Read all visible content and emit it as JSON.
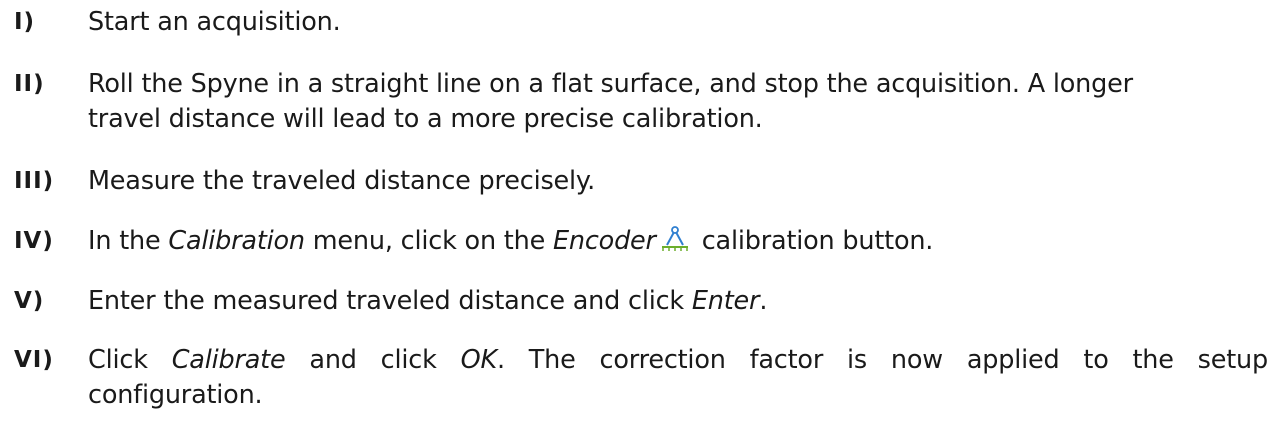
{
  "steps": [
    {
      "number": "I)",
      "text": "Start an acquisition."
    },
    {
      "number": "II)",
      "line1": "Roll the Spyne in a straight line on a flat surface, and stop the acquisition. A longer",
      "line2": "travel distance will lead to a more precise calibration."
    },
    {
      "number": "III)",
      "text": "Measure the traveled distance precisely."
    },
    {
      "number": "IV)",
      "pre": "In the ",
      "menu": "Calibration",
      "mid": " menu, click on the ",
      "button": "Encoder",
      "post": " calibration button.",
      "icon": "encoder-calibration-icon"
    },
    {
      "number": "V)",
      "pre": "Enter the measured traveled distance and click ",
      "key": "Enter",
      "post": "."
    },
    {
      "number": "VI)",
      "pre": "Click ",
      "calibrate": "Calibrate",
      "mid": " and click ",
      "ok": "OK",
      "post_line1": ". The correction factor is now applied to the setup",
      "line2": "configuration."
    }
  ],
  "colors": {
    "text": "#1a1a1a",
    "icon_blue": "#2f7fd0",
    "icon_green": "#6cae2c"
  }
}
